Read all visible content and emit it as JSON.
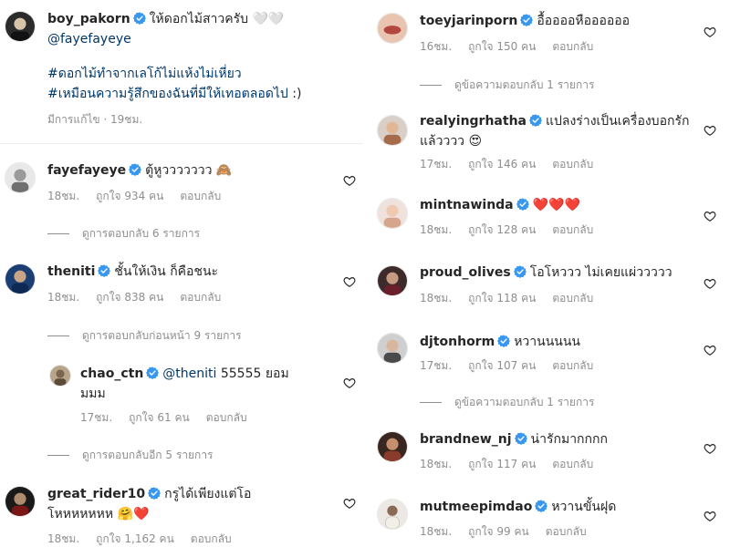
{
  "caption": {
    "username": "boy_pakorn",
    "text": "ให้ดอกไม้สาวครับ",
    "hearts_emoji": "🤍🤍",
    "mention": "@fayefayeye",
    "hashtag1": "#ดอกไม้ทำจากเลโก้ไม่แห้งไม่เหี่ยว",
    "hashtag2": "#เหมือนความรู้สึกของฉันที่มีให้เทอตลอดไป",
    "hashtag2_suffix": " :)",
    "edited": "มีการแก้ไข · 19ชม."
  },
  "left_comments": [
    {
      "username": "fayefayeye",
      "text": "ตู้หูววววววว",
      "emoji": "🙈",
      "time": "18ชม.",
      "likes": "ถูกใจ 934 คน",
      "reply": "ตอบกลับ"
    },
    {
      "username": "theniti",
      "text": "ชั้นให้เงิน ก็คือชนะ",
      "emoji": "",
      "time": "18ชม.",
      "likes": "ถูกใจ 838 คน",
      "reply": "ตอบกลับ"
    },
    {
      "username": "chao_ctn",
      "mention": "@theniti",
      "text_a": " 55555 ยอม",
      "text_b": "มมม",
      "time": "17ชม.",
      "likes": "ถูกใจ 61 คน",
      "reply": "ตอบกลับ"
    },
    {
      "username": "great_rider10",
      "text_a": "กรูได้เพียงแต่โอ",
      "text_b": "โหหหหหหห",
      "emoji": "🤗❤️",
      "time": "18ชม.",
      "likes": "ถูกใจ 1,162 คน",
      "reply": "ตอบกลับ"
    }
  ],
  "left_threads": {
    "view_replies_6": "ดูการตอบกลับ 6 รายการ",
    "view_prev_9": "ดูการตอบกลับก่อนหน้า 9 รายการ",
    "view_more_5": "ดูการตอบกลับอีก 5 รายการ"
  },
  "right_comments": [
    {
      "username": "toeyjarinporn",
      "text": "อื้ออออหืออออออ",
      "time": "16ชม.",
      "likes": "ถูกใจ 150 คน",
      "reply": "ตอบกลับ"
    },
    {
      "username": "realyingrhatha",
      "text_a": "แปลงร่างเป็นเครื่องบอกรัก",
      "text_b": "แล้วววว",
      "emoji": "😍",
      "time": "17ชม.",
      "likes": "ถูกใจ 146 คน",
      "reply": "ตอบกลับ"
    },
    {
      "username": "mintnawinda",
      "text": "",
      "emoji": "❤️❤️❤️",
      "time": "18ชม.",
      "likes": "ถูกใจ 128 คน",
      "reply": "ตอบกลับ"
    },
    {
      "username": "proud_olives",
      "text": "โอโหววว ไม่เคยแผ่ววววว",
      "time": "18ชม.",
      "likes": "ถูกใจ 118 คน",
      "reply": "ตอบกลับ"
    },
    {
      "username": "djtonhorm",
      "text": "หวานนนนน",
      "time": "17ชม.",
      "likes": "ถูกใจ 107 คน",
      "reply": "ตอบกลับ"
    },
    {
      "username": "brandnew_nj",
      "text": "น่ารักมากกกก",
      "time": "18ชม.",
      "likes": "ถูกใจ 117 คน",
      "reply": "ตอบกลับ"
    },
    {
      "username": "mutmeepimdao",
      "text": "หวานขั้นฝุด",
      "time": "18ชม.",
      "likes": "ถูกใจ 99 คน",
      "reply": "ตอบกลับ"
    }
  ],
  "right_threads": {
    "view_reply_1a": "ดูข้อความตอบกลับ 1 รายการ",
    "view_reply_1b": "ดูข้อความตอบกลับ 1 รายการ"
  },
  "colors": {
    "verified_blue": "#3897f0",
    "link_blue": "#00376b",
    "muted_gray": "#8e8e8e",
    "text_dark": "#262626"
  }
}
